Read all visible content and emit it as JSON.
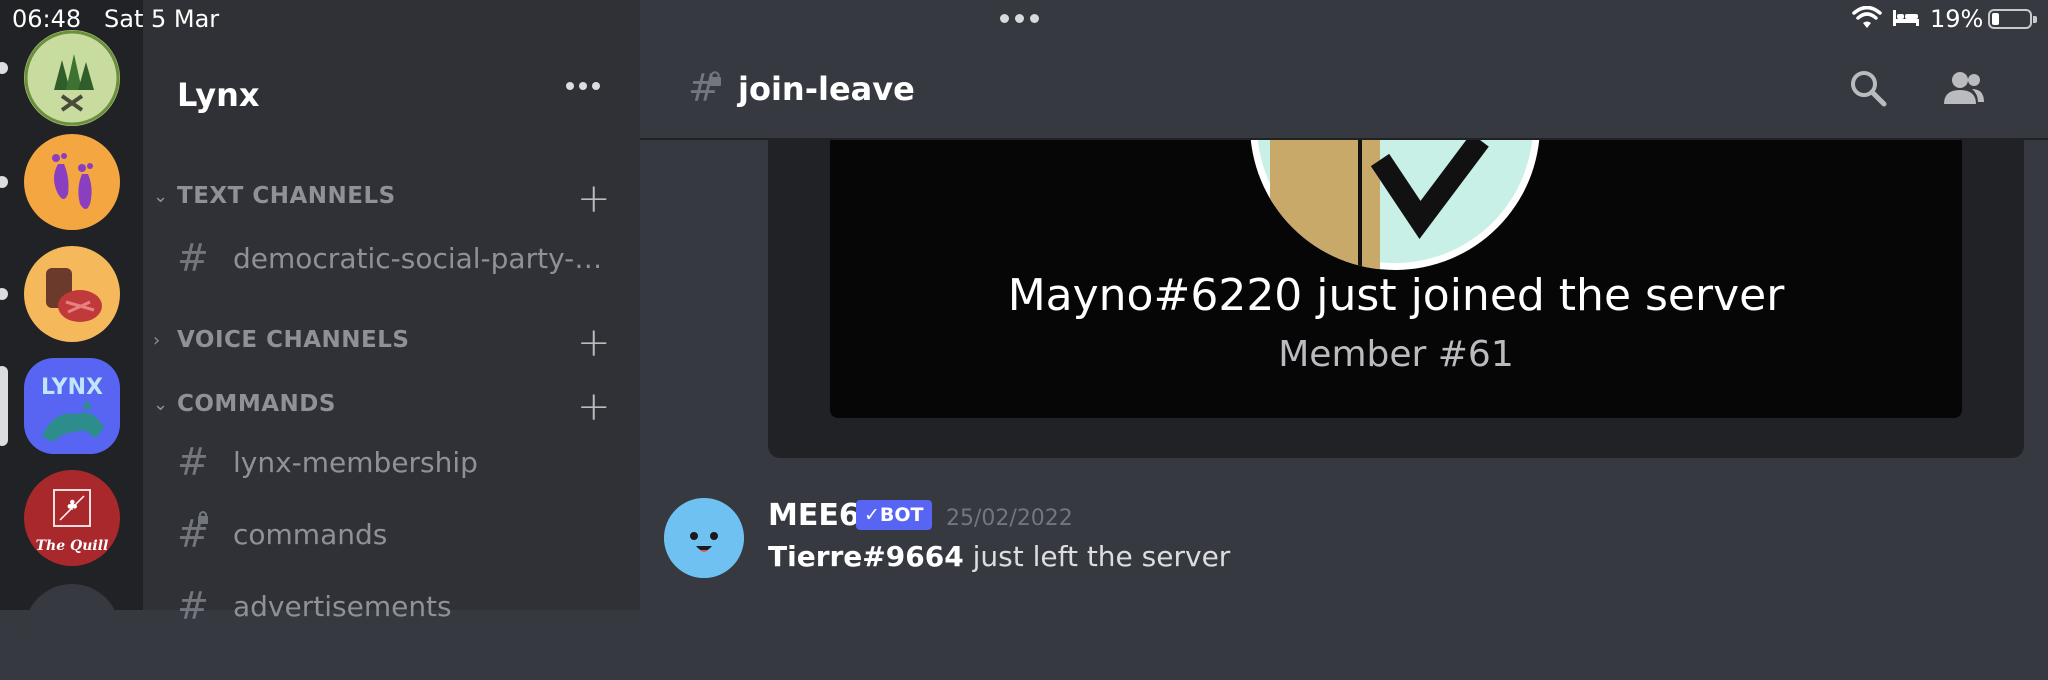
{
  "status_bar": {
    "time": "06:48",
    "date": "Sat 5 Mar",
    "battery_pct": "19%",
    "battery_level": 0.19
  },
  "server": {
    "name": "Lynx"
  },
  "servers": [
    {
      "name": "forest-server"
    },
    {
      "name": "feet-server"
    },
    {
      "name": "meat-server"
    },
    {
      "name": "Lynx",
      "logo_text": "LYNX",
      "active": true
    },
    {
      "name": "The Quill",
      "logo_text": "The Quill"
    }
  ],
  "sidebar": {
    "categories": [
      {
        "label": "TEXT CHANNELS",
        "expanded": true
      },
      {
        "label": "VOICE CHANNELS",
        "expanded": false
      },
      {
        "label": "COMMANDS",
        "expanded": true
      }
    ],
    "channels": [
      {
        "name": "democratic-social-party-a...",
        "locked": false
      },
      {
        "name": "lynx-membership",
        "locked": false
      },
      {
        "name": "commands",
        "locked": true
      },
      {
        "name": "advertisements",
        "locked": false
      }
    ]
  },
  "channel_header": {
    "title": "join-leave",
    "locked": true
  },
  "welcome_card": {
    "joined_text": "Mayno#6220 just joined the server",
    "member_text": "Member #61"
  },
  "message": {
    "author": "MEE6",
    "tag": "✓BOT",
    "timestamp": "25/02/2022",
    "user": "Tierre#9664",
    "text": " just left the server"
  },
  "colors": {
    "accent": "#5865f2",
    "bg_main": "#36393f",
    "bg_sidebar": "#2f3136",
    "bg_rail": "#202225"
  }
}
